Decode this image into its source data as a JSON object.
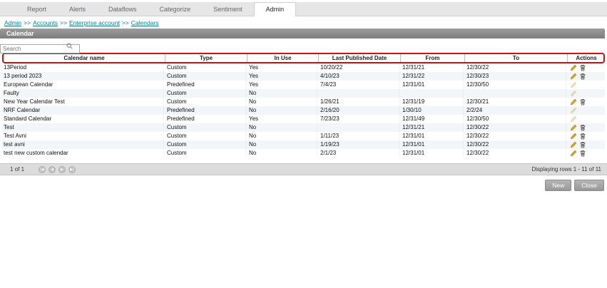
{
  "tabs": [
    {
      "label": "Report"
    },
    {
      "label": "Alerts"
    },
    {
      "label": "Dataflows"
    },
    {
      "label": "Categorize"
    },
    {
      "label": "Sentiment"
    },
    {
      "label": "Admin"
    }
  ],
  "active_tab": "Admin",
  "breadcrumb": {
    "separator": ">>",
    "items": [
      "Admin",
      "Accounts",
      "Enterprise account",
      "Calendars"
    ]
  },
  "page": {
    "title": "Calendar"
  },
  "search": {
    "placeholder": "Search",
    "icon": "magnifier-icon"
  },
  "table": {
    "columns": [
      "Calendar name",
      "Type",
      "In Use",
      "Last Published Date",
      "From",
      "To",
      "Actions"
    ],
    "action_icons": {
      "edit": "pencil-icon",
      "delete": "trash-icon"
    },
    "rows": [
      {
        "name": "13Period",
        "type": "Custom",
        "in_use": "Yes",
        "last_published": "10/20/22",
        "from": "12/31/21",
        "to": "12/30/22",
        "edit": "normal",
        "delete": true
      },
      {
        "name": "13 period 2023",
        "type": "Custom",
        "in_use": "Yes",
        "last_published": "4/10/23",
        "from": "12/31/22",
        "to": "12/30/23",
        "edit": "normal",
        "delete": true
      },
      {
        "name": "European Calendar",
        "type": "Predefined",
        "in_use": "Yes",
        "last_published": "7/4/23",
        "from": "12/31/01",
        "to": "12/30/50",
        "edit": "faded",
        "delete": false
      },
      {
        "name": "Faulty",
        "type": "Custom",
        "in_use": "No",
        "last_published": "",
        "from": "",
        "to": "",
        "edit": "faded",
        "delete": false
      },
      {
        "name": "New Year Calendar Test",
        "type": "Custom",
        "in_use": "No",
        "last_published": "1/26/21",
        "from": "12/31/19",
        "to": "12/30/21",
        "edit": "normal",
        "delete": true
      },
      {
        "name": "NRF Calendar",
        "type": "Predefined",
        "in_use": "No",
        "last_published": "2/16/20",
        "from": "1/30/10",
        "to": "2/2/24",
        "edit": "faded",
        "delete": false
      },
      {
        "name": "Standard Calendar",
        "type": "Predefined",
        "in_use": "Yes",
        "last_published": "7/23/23",
        "from": "12/31/49",
        "to": "12/30/50",
        "edit": "faded",
        "delete": false
      },
      {
        "name": "Test",
        "type": "Custom",
        "in_use": "No",
        "last_published": "",
        "from": "12/31/21",
        "to": "12/30/22",
        "edit": "normal",
        "delete": true
      },
      {
        "name": "Test Avni",
        "type": "Custom",
        "in_use": "No",
        "last_published": "1/11/23",
        "from": "12/31/01",
        "to": "12/30/22",
        "edit": "normal",
        "delete": true
      },
      {
        "name": "test avni",
        "type": "Custom",
        "in_use": "No",
        "last_published": "1/19/23",
        "from": "12/31/01",
        "to": "12/30/22",
        "edit": "normal",
        "delete": true
      },
      {
        "name": "test new custom calendar",
        "type": "Custom",
        "in_use": "No",
        "last_published": "2/1/23",
        "from": "12/31/01",
        "to": "12/30/22",
        "edit": "normal",
        "delete": true
      }
    ]
  },
  "pagination": {
    "page_label": "1 of 1",
    "buttons": [
      {
        "name": "first",
        "glyph": "|◀"
      },
      {
        "name": "prev",
        "glyph": "◀"
      },
      {
        "name": "next",
        "glyph": "▶"
      },
      {
        "name": "last",
        "glyph": "▶|"
      }
    ],
    "displaying": "Displaying rows 1 - 11 of 11"
  },
  "buttons": {
    "new_label": "New",
    "close_label": "Close"
  },
  "colors": {
    "header_border_red": "#cc1111",
    "link_teal": "#0b7f8e",
    "title_bar_gray": "#8c8c8c",
    "pencil_gold": "#d8a92a",
    "trash_gray": "#444444"
  }
}
